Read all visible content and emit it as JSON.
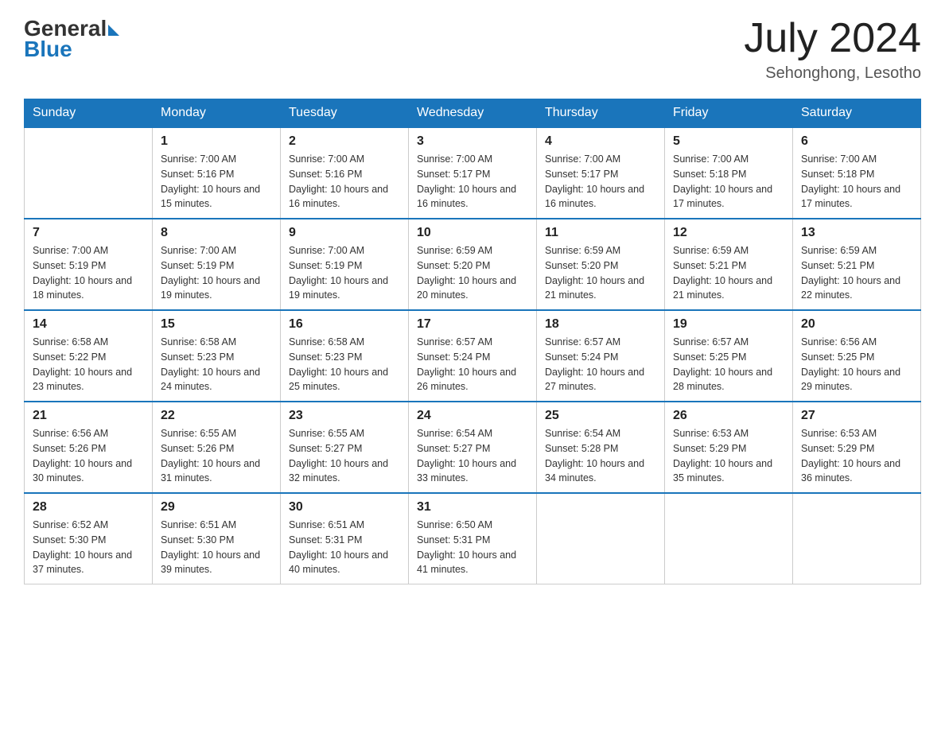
{
  "logo": {
    "general": "General",
    "blue": "Blue"
  },
  "title": "July 2024",
  "location": "Sehonghong, Lesotho",
  "days_of_week": [
    "Sunday",
    "Monday",
    "Tuesday",
    "Wednesday",
    "Thursday",
    "Friday",
    "Saturday"
  ],
  "weeks": [
    [
      {
        "day": "",
        "info": ""
      },
      {
        "day": "1",
        "info": "Sunrise: 7:00 AM\nSunset: 5:16 PM\nDaylight: 10 hours and 15 minutes."
      },
      {
        "day": "2",
        "info": "Sunrise: 7:00 AM\nSunset: 5:16 PM\nDaylight: 10 hours and 16 minutes."
      },
      {
        "day": "3",
        "info": "Sunrise: 7:00 AM\nSunset: 5:17 PM\nDaylight: 10 hours and 16 minutes."
      },
      {
        "day": "4",
        "info": "Sunrise: 7:00 AM\nSunset: 5:17 PM\nDaylight: 10 hours and 16 minutes."
      },
      {
        "day": "5",
        "info": "Sunrise: 7:00 AM\nSunset: 5:18 PM\nDaylight: 10 hours and 17 minutes."
      },
      {
        "day": "6",
        "info": "Sunrise: 7:00 AM\nSunset: 5:18 PM\nDaylight: 10 hours and 17 minutes."
      }
    ],
    [
      {
        "day": "7",
        "info": "Sunrise: 7:00 AM\nSunset: 5:19 PM\nDaylight: 10 hours and 18 minutes."
      },
      {
        "day": "8",
        "info": "Sunrise: 7:00 AM\nSunset: 5:19 PM\nDaylight: 10 hours and 19 minutes."
      },
      {
        "day": "9",
        "info": "Sunrise: 7:00 AM\nSunset: 5:19 PM\nDaylight: 10 hours and 19 minutes."
      },
      {
        "day": "10",
        "info": "Sunrise: 6:59 AM\nSunset: 5:20 PM\nDaylight: 10 hours and 20 minutes."
      },
      {
        "day": "11",
        "info": "Sunrise: 6:59 AM\nSunset: 5:20 PM\nDaylight: 10 hours and 21 minutes."
      },
      {
        "day": "12",
        "info": "Sunrise: 6:59 AM\nSunset: 5:21 PM\nDaylight: 10 hours and 21 minutes."
      },
      {
        "day": "13",
        "info": "Sunrise: 6:59 AM\nSunset: 5:21 PM\nDaylight: 10 hours and 22 minutes."
      }
    ],
    [
      {
        "day": "14",
        "info": "Sunrise: 6:58 AM\nSunset: 5:22 PM\nDaylight: 10 hours and 23 minutes."
      },
      {
        "day": "15",
        "info": "Sunrise: 6:58 AM\nSunset: 5:23 PM\nDaylight: 10 hours and 24 minutes."
      },
      {
        "day": "16",
        "info": "Sunrise: 6:58 AM\nSunset: 5:23 PM\nDaylight: 10 hours and 25 minutes."
      },
      {
        "day": "17",
        "info": "Sunrise: 6:57 AM\nSunset: 5:24 PM\nDaylight: 10 hours and 26 minutes."
      },
      {
        "day": "18",
        "info": "Sunrise: 6:57 AM\nSunset: 5:24 PM\nDaylight: 10 hours and 27 minutes."
      },
      {
        "day": "19",
        "info": "Sunrise: 6:57 AM\nSunset: 5:25 PM\nDaylight: 10 hours and 28 minutes."
      },
      {
        "day": "20",
        "info": "Sunrise: 6:56 AM\nSunset: 5:25 PM\nDaylight: 10 hours and 29 minutes."
      }
    ],
    [
      {
        "day": "21",
        "info": "Sunrise: 6:56 AM\nSunset: 5:26 PM\nDaylight: 10 hours and 30 minutes."
      },
      {
        "day": "22",
        "info": "Sunrise: 6:55 AM\nSunset: 5:26 PM\nDaylight: 10 hours and 31 minutes."
      },
      {
        "day": "23",
        "info": "Sunrise: 6:55 AM\nSunset: 5:27 PM\nDaylight: 10 hours and 32 minutes."
      },
      {
        "day": "24",
        "info": "Sunrise: 6:54 AM\nSunset: 5:27 PM\nDaylight: 10 hours and 33 minutes."
      },
      {
        "day": "25",
        "info": "Sunrise: 6:54 AM\nSunset: 5:28 PM\nDaylight: 10 hours and 34 minutes."
      },
      {
        "day": "26",
        "info": "Sunrise: 6:53 AM\nSunset: 5:29 PM\nDaylight: 10 hours and 35 minutes."
      },
      {
        "day": "27",
        "info": "Sunrise: 6:53 AM\nSunset: 5:29 PM\nDaylight: 10 hours and 36 minutes."
      }
    ],
    [
      {
        "day": "28",
        "info": "Sunrise: 6:52 AM\nSunset: 5:30 PM\nDaylight: 10 hours and 37 minutes."
      },
      {
        "day": "29",
        "info": "Sunrise: 6:51 AM\nSunset: 5:30 PM\nDaylight: 10 hours and 39 minutes."
      },
      {
        "day": "30",
        "info": "Sunrise: 6:51 AM\nSunset: 5:31 PM\nDaylight: 10 hours and 40 minutes."
      },
      {
        "day": "31",
        "info": "Sunrise: 6:50 AM\nSunset: 5:31 PM\nDaylight: 10 hours and 41 minutes."
      },
      {
        "day": "",
        "info": ""
      },
      {
        "day": "",
        "info": ""
      },
      {
        "day": "",
        "info": ""
      }
    ]
  ]
}
